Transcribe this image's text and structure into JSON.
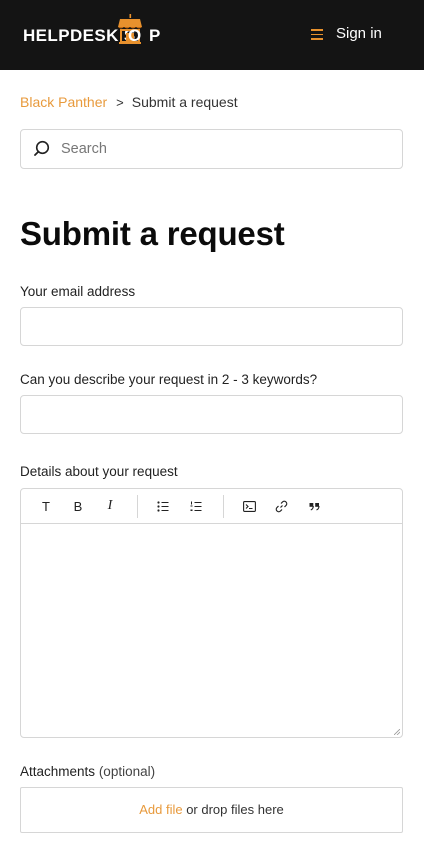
{
  "header": {
    "logo": {
      "part1": "HELPDESK S",
      "part2": "O",
      "part3": "P"
    },
    "menu_icon": "hamburger-menu-icon",
    "signin_label": "Sign in",
    "accent_color": "#e8912d",
    "background_color": "#141414"
  },
  "breadcrumb": {
    "parent": "Black Panther",
    "separator": ">",
    "current": "Submit a request"
  },
  "search": {
    "placeholder": "Search",
    "value": ""
  },
  "page_title": "Submit a request",
  "form": {
    "email": {
      "label": "Your email address",
      "value": ""
    },
    "subject": {
      "label": "Can you describe your request in 2 - 3 keywords?",
      "value": ""
    },
    "details": {
      "label": "Details about your request",
      "value": "",
      "toolbar": {
        "text_label": "T",
        "bold_label": "B",
        "italic_label": "I",
        "bullet_icon": "bulleted-list-icon",
        "numbered_icon": "numbered-list-icon",
        "code_icon": "code-block-icon",
        "link_icon": "link-icon",
        "quote_icon": "quote-icon"
      }
    },
    "attachments": {
      "label": "Attachments",
      "optional": "(optional)",
      "add_file": "Add file",
      "drop_text": " or drop files here"
    }
  }
}
